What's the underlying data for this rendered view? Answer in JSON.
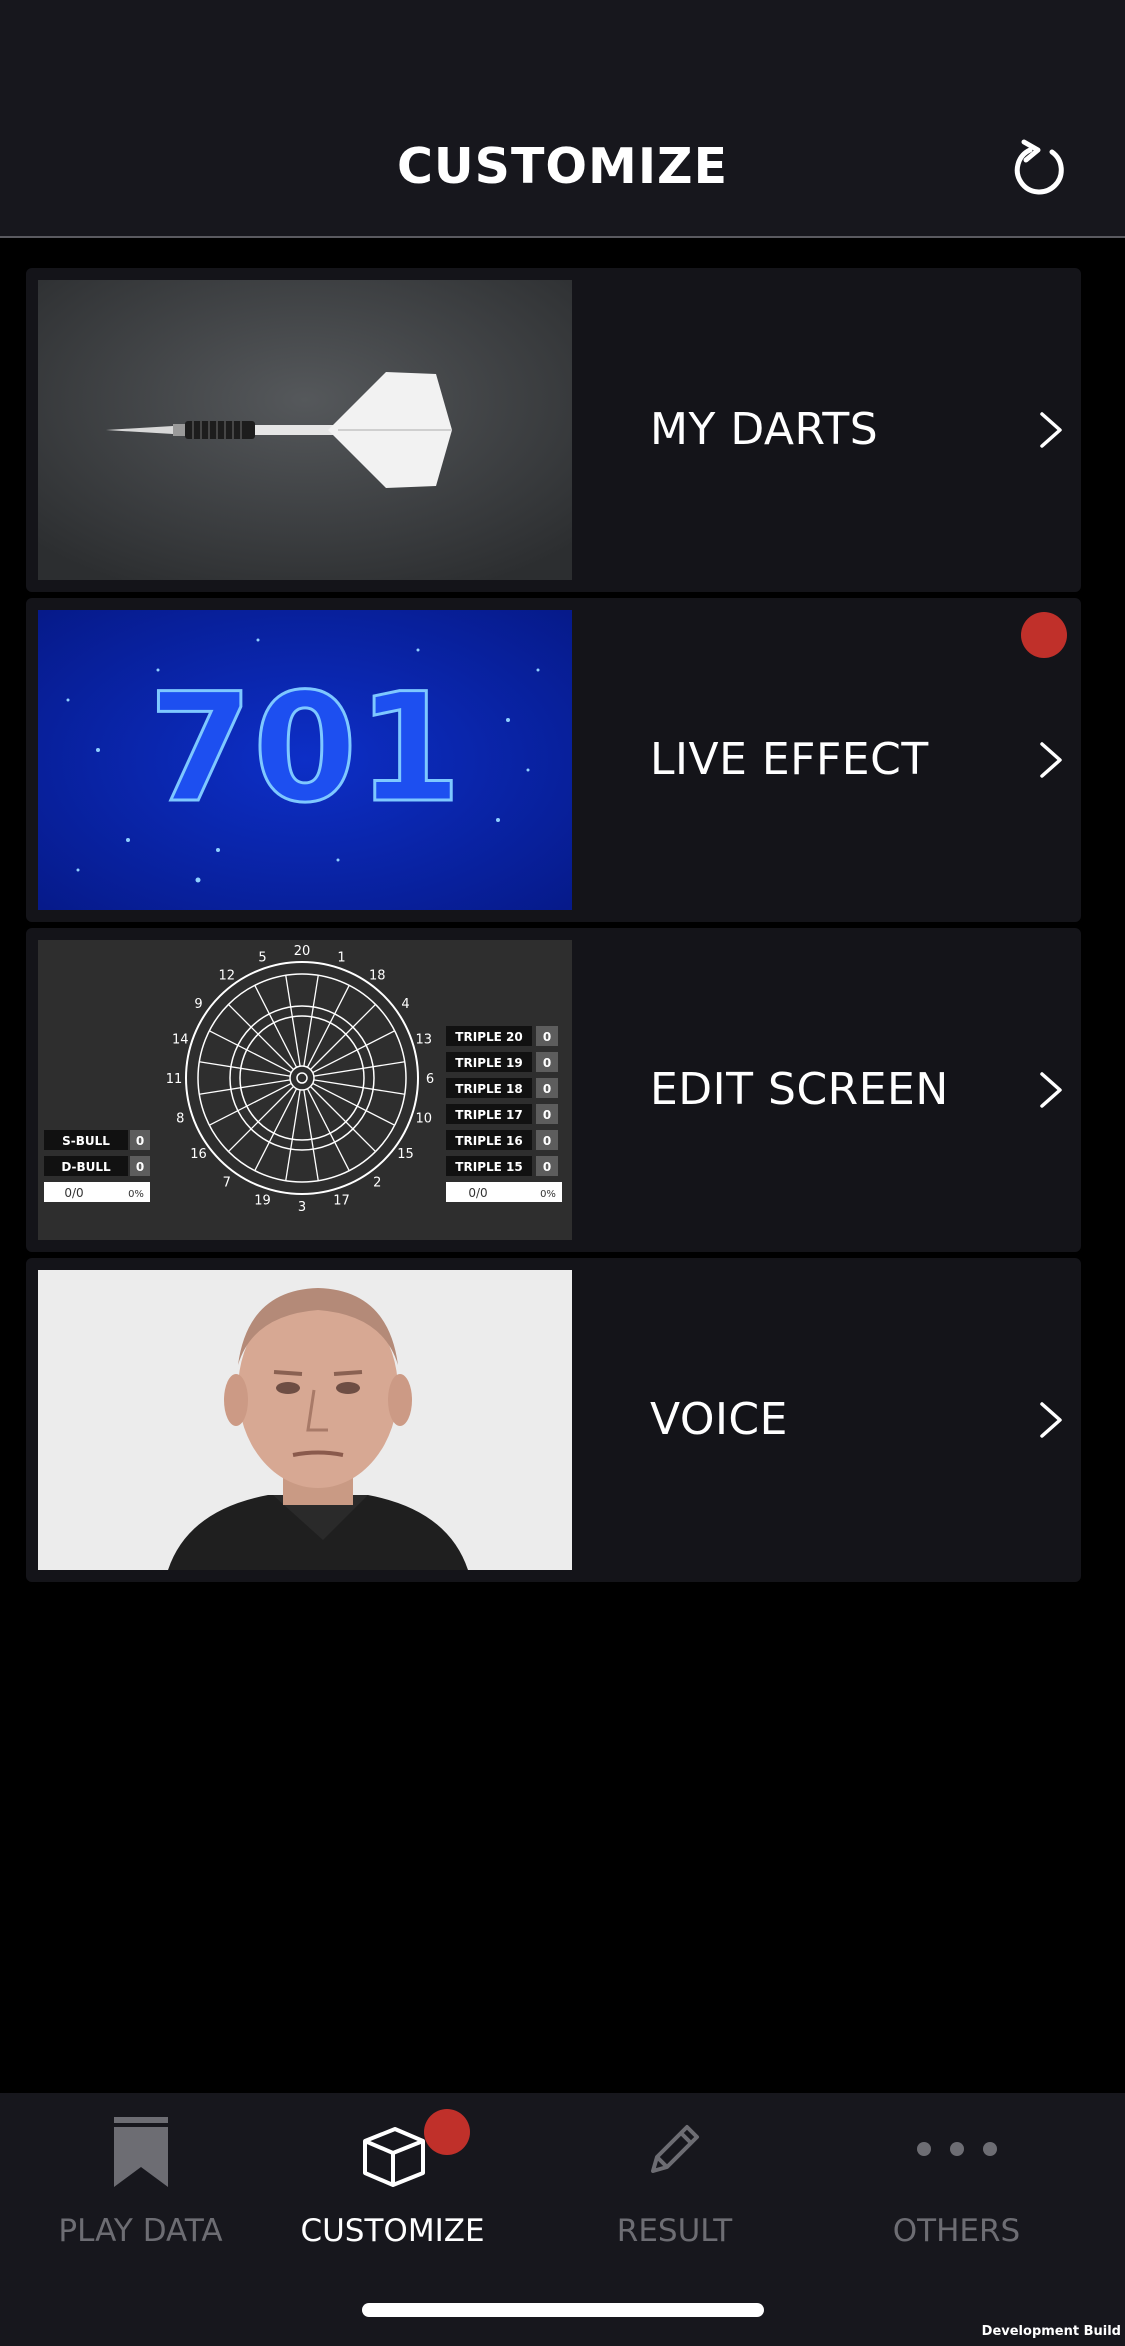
{
  "header": {
    "title": "CUSTOMIZE",
    "refresh_icon": "refresh-icon"
  },
  "menu": [
    {
      "label": "MY DARTS",
      "icon": "chevron-right-icon",
      "badge": false
    },
    {
      "label": "LIVE EFFECT",
      "icon": "chevron-right-icon",
      "badge": true,
      "badge_color": "#c0302a"
    },
    {
      "label": "EDIT SCREEN",
      "icon": "chevron-right-icon",
      "badge": false
    },
    {
      "label": "VOICE",
      "icon": "chevron-right-icon",
      "badge": false
    }
  ],
  "live_effect_preview": {
    "number": "701"
  },
  "edit_screen_preview": {
    "board_numbers": [
      "20",
      "1",
      "18",
      "4",
      "13",
      "6",
      "10",
      "15",
      "2",
      "17",
      "3",
      "19",
      "7",
      "16",
      "8",
      "11",
      "14",
      "9",
      "12",
      "5"
    ],
    "left_rows": [
      {
        "label": "S-BULL",
        "value": "0"
      },
      {
        "label": "D-BULL",
        "value": "0"
      }
    ],
    "left_footer": {
      "ratio": "0/0",
      "percent": "0%"
    },
    "right_rows": [
      {
        "label": "TRIPLE 20",
        "value": "0"
      },
      {
        "label": "TRIPLE 19",
        "value": "0"
      },
      {
        "label": "TRIPLE 18",
        "value": "0"
      },
      {
        "label": "TRIPLE 17",
        "value": "0"
      },
      {
        "label": "TRIPLE 16",
        "value": "0"
      },
      {
        "label": "TRIPLE 15",
        "value": "0"
      }
    ],
    "right_footer": {
      "ratio": "0/0",
      "percent": "0%"
    }
  },
  "tabbar": {
    "tabs": [
      {
        "label": "PLAY DATA",
        "icon": "bookmark-icon",
        "active": false
      },
      {
        "label": "CUSTOMIZE",
        "icon": "cube-icon",
        "active": true,
        "badge": true
      },
      {
        "label": "RESULT",
        "icon": "pencil-icon",
        "active": false
      },
      {
        "label": "OTHERS",
        "icon": "more-dots-icon",
        "active": false
      }
    ]
  },
  "footer": {
    "build_label": "Development Build"
  },
  "colors": {
    "background": "#000000",
    "header": "#17171d",
    "card": "#141419",
    "badge": "#c0302a",
    "inactive_tab": "#6d6d73"
  }
}
